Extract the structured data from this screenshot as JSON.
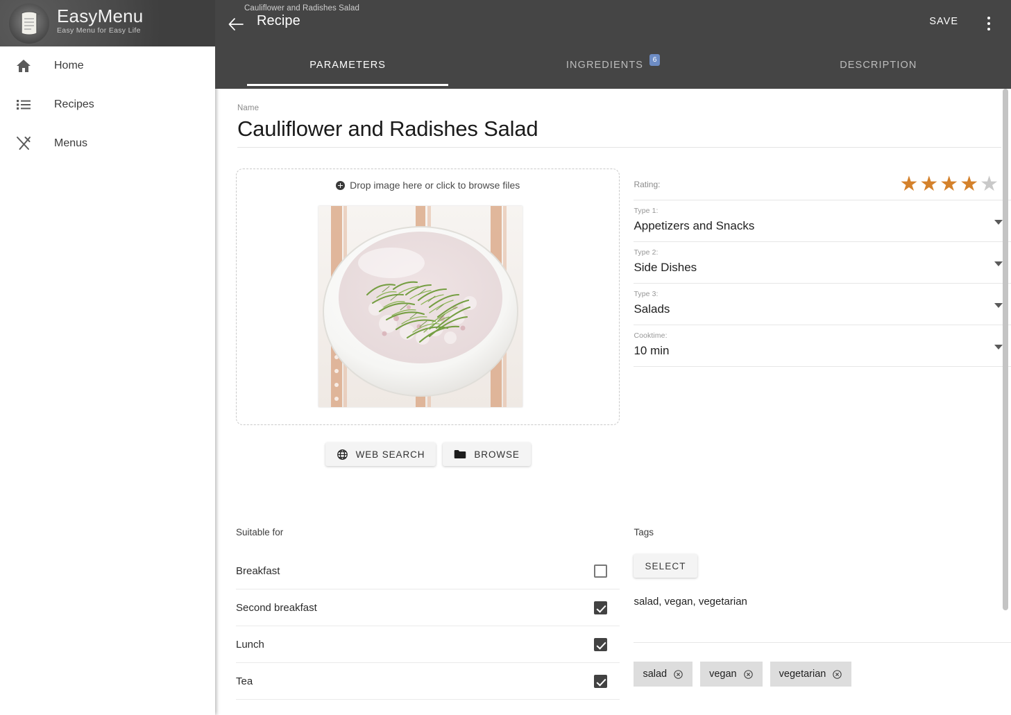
{
  "brand": {
    "title": "EasyMenu",
    "tagline": "Easy Menu for Easy Life",
    "logo_icon": "scroll-document-icon"
  },
  "sidebar": {
    "items": [
      {
        "label": "Home",
        "icon": "home-icon"
      },
      {
        "label": "Recipes",
        "icon": "list-icon"
      },
      {
        "label": "Menus",
        "icon": "fork-knife-icon"
      }
    ]
  },
  "header": {
    "back_icon": "back-arrow-icon",
    "subtitle": "Cauliflower and Radishes Salad",
    "title": "Recipe",
    "save_label": "SAVE",
    "overflow_icon": "kebab-menu-icon"
  },
  "tabs": [
    {
      "label": "PARAMETERS",
      "active": true,
      "badge": ""
    },
    {
      "label": "INGREDIENTS",
      "active": false,
      "badge": "6"
    },
    {
      "label": "DESCRIPTION",
      "active": false,
      "badge": ""
    }
  ],
  "name_field": {
    "label": "Name",
    "value": "Cauliflower and Radishes Salad"
  },
  "image_panel": {
    "drop_hint": "Drop image here or click to browse files",
    "plus_icon": "plus-circle-icon",
    "photo_alt": "white bowl of cauliflower and radish salad topped with dill on a striped cloth",
    "buttons": [
      {
        "label": "WEB SEARCH",
        "icon": "globe-icon"
      },
      {
        "label": "BROWSE",
        "icon": "folder-icon"
      }
    ]
  },
  "properties": {
    "rating": {
      "label": "Rating:",
      "value": 4,
      "max": 5,
      "on_color": "#d4812b",
      "off_color": "#c9c9c9"
    },
    "fields": [
      {
        "label": "Type 1:",
        "value": "Appetizers and Snacks"
      },
      {
        "label": "Type 2:",
        "value": "Side Dishes"
      },
      {
        "label": "Type 3:",
        "value": "Salads"
      },
      {
        "label": "Cooktime:",
        "value": "10 min"
      }
    ]
  },
  "suitable_for": {
    "label": "Suitable for",
    "rows": [
      {
        "label": "Breakfast",
        "checked": false
      },
      {
        "label": "Second breakfast",
        "checked": true
      },
      {
        "label": "Lunch",
        "checked": true
      },
      {
        "label": "Tea",
        "checked": true
      }
    ]
  },
  "tags": {
    "label": "Tags",
    "select_label": "SELECT",
    "summary": "salad, vegan, vegetarian",
    "chips": [
      {
        "label": "salad",
        "remove_icon": "circle-x-icon"
      },
      {
        "label": "vegan",
        "remove_icon": "circle-x-icon"
      },
      {
        "label": "vegetarian",
        "remove_icon": "circle-x-icon"
      }
    ]
  },
  "colors": {
    "header_bg": "#454545",
    "badge_blue": "#6d8cc4",
    "checkbox": "#424242",
    "star_on": "#d4812b"
  }
}
